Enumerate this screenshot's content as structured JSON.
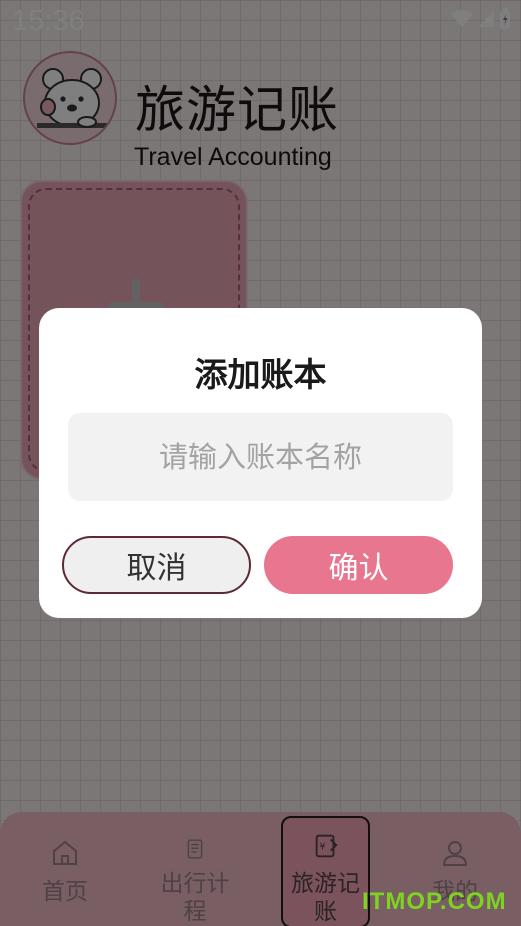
{
  "status_bar": {
    "time": "15:36",
    "icons": [
      "wifi-icon",
      "signal-icon",
      "battery-icon"
    ]
  },
  "header": {
    "title": "旅游记账",
    "subtitle": "Travel Accounting",
    "logo": "bear-logo-icon"
  },
  "add_book_card": {
    "icon": "plus-icon"
  },
  "dialog": {
    "title": "添加账本",
    "input": {
      "placeholder": "请输入账本名称",
      "value": ""
    },
    "cancel_label": "取消",
    "confirm_label": "确认"
  },
  "bottom_nav": {
    "items": [
      {
        "label": "首页",
        "icon": "home-icon"
      },
      {
        "label": "出行计程",
        "icon": "notebook-icon"
      },
      {
        "label": "旅游记账",
        "icon": "bill-icon",
        "active": true
      },
      {
        "label": "我的",
        "icon": "user-icon"
      }
    ]
  },
  "watermark": "ITMOP.COM",
  "colors": {
    "accent": "#e9768f",
    "overlay": "rgba(0,0,0,0.5)",
    "card": "#e9a7b6",
    "nav_bg": "#f2bcc8"
  }
}
